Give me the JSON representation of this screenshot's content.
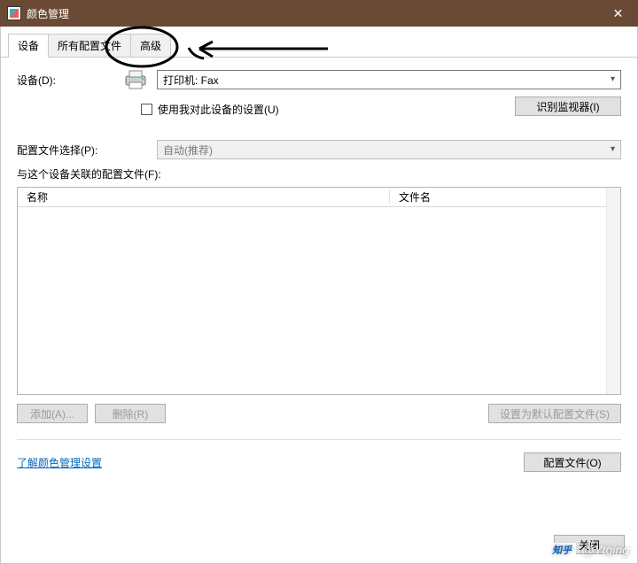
{
  "window": {
    "title": "颜色管理",
    "close_glyph": "✕"
  },
  "tabs": [
    {
      "label": "设备",
      "active": true
    },
    {
      "label": "所有配置文件",
      "active": false
    },
    {
      "label": "高级",
      "active": false
    }
  ],
  "device": {
    "label": "设备(D):",
    "value": "打印机: Fax"
  },
  "use_my_settings": {
    "label": "使用我对此设备的设置(U)",
    "checked": false
  },
  "identify_button": "识别监视器(I)",
  "profile_select": {
    "label": "配置文件选择(P):",
    "value": "自动(推荐)"
  },
  "associated_label": "与这个设备关联的配置文件(F):",
  "list_headers": {
    "name": "名称",
    "filename": "文件名"
  },
  "buttons": {
    "add": "添加(A)...",
    "remove": "删除(R)",
    "set_default": "设置为默认配置文件(S)",
    "profiles": "配置文件(O)",
    "close": "关闭"
  },
  "link": "了解颜色管理设置",
  "watermark": {
    "logo": "知乎",
    "user": "@Ytqing"
  }
}
